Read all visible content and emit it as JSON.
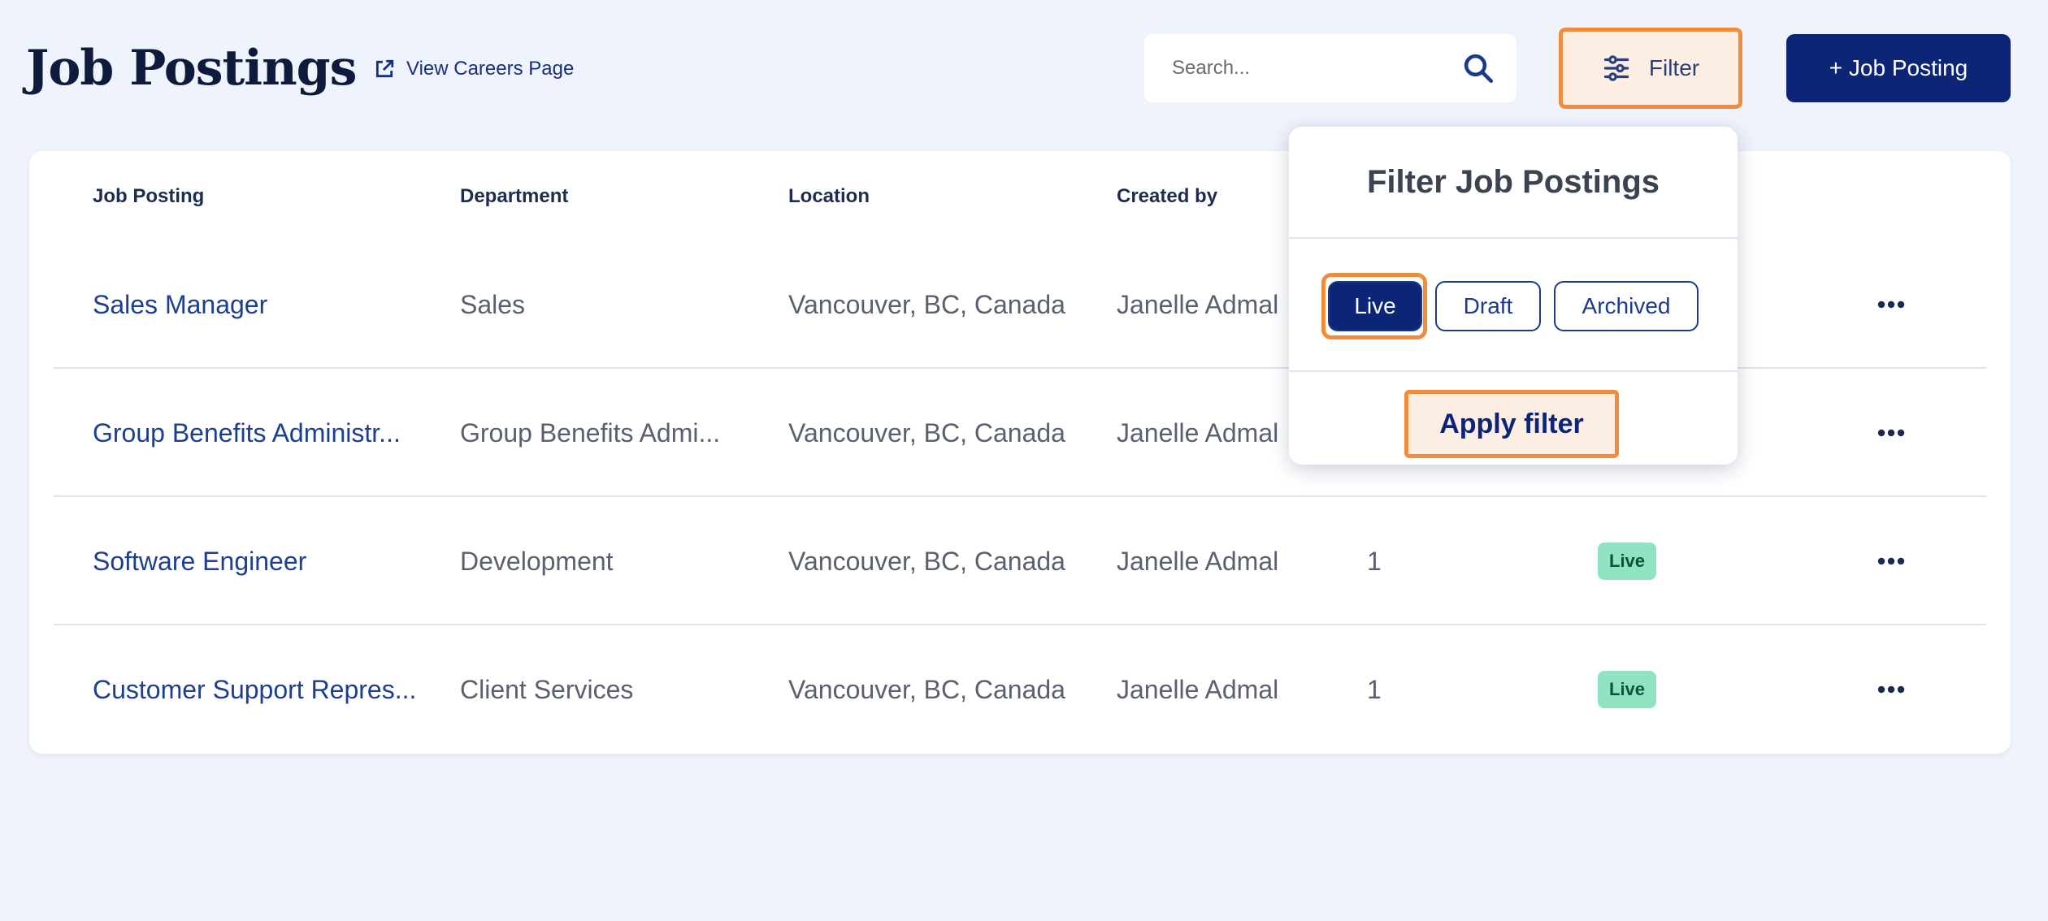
{
  "header": {
    "title": "Job Postings",
    "careers_link": "View Careers Page",
    "search_placeholder": "Search...",
    "filter_label": "Filter",
    "add_label": "+ Job Posting"
  },
  "table": {
    "columns": [
      "Job Posting",
      "Department",
      "Location",
      "Created by"
    ],
    "rows": [
      {
        "title": "Sales Manager",
        "department": "Sales",
        "location": "Vancouver, BC, Canada",
        "created_by": "Janelle Admal",
        "count": "",
        "status": ""
      },
      {
        "title": "Group Benefits Administr...",
        "department": "Group Benefits Admi...",
        "location": "Vancouver, BC, Canada",
        "created_by": "Janelle Admal",
        "count": "",
        "status": ""
      },
      {
        "title": "Software Engineer",
        "department": "Development",
        "location": "Vancouver, BC, Canada",
        "created_by": "Janelle Admal",
        "count": "1",
        "status": "Live"
      },
      {
        "title": "Customer Support Repres...",
        "department": "Client Services",
        "location": "Vancouver, BC, Canada",
        "created_by": "Janelle Admal",
        "count": "1",
        "status": "Live"
      }
    ]
  },
  "filter_popover": {
    "title": "Filter Job Postings",
    "options": [
      "Live",
      "Draft",
      "Archived"
    ],
    "selected": "Live",
    "apply_label": "Apply filter"
  },
  "colors": {
    "background": "#eff3fb",
    "primary": "#0c2577",
    "highlight": "#f28c3a",
    "live_badge": "#8fe3c0"
  }
}
